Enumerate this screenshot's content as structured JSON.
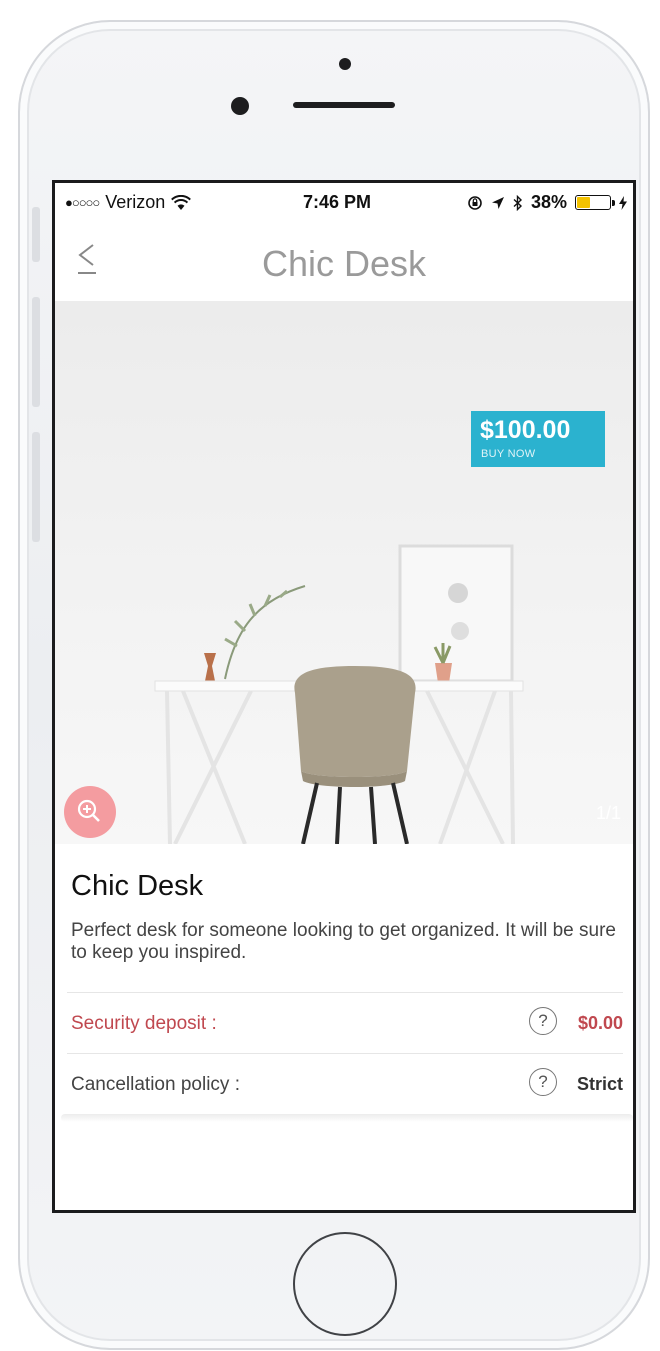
{
  "status_bar": {
    "carrier": "Verizon",
    "signal_dots": "●○○○○",
    "time": "7:46 PM",
    "battery": "38%"
  },
  "nav": {
    "title": "Chic Desk",
    "back_icon": "chevron-left-icon"
  },
  "hero": {
    "price": "$100.00",
    "buy_label": "BUY NOW",
    "image_counter": "1/1",
    "zoom_icon": "zoom-in-icon"
  },
  "item": {
    "title": "Chic Desk",
    "description": "Perfect desk for someone looking to get organized. It will be sure to keep you inspired."
  },
  "rows": [
    {
      "label": "Security deposit :",
      "value": "$0.00"
    },
    {
      "label": "Cancellation policy :",
      "value": "Strict"
    }
  ],
  "help_glyph": "?",
  "colors": {
    "price_tag": "#2bb2cf",
    "accent_red": "#c0484f",
    "zoom_button": "#f49ca0",
    "battery_fill": "#f3c200"
  }
}
